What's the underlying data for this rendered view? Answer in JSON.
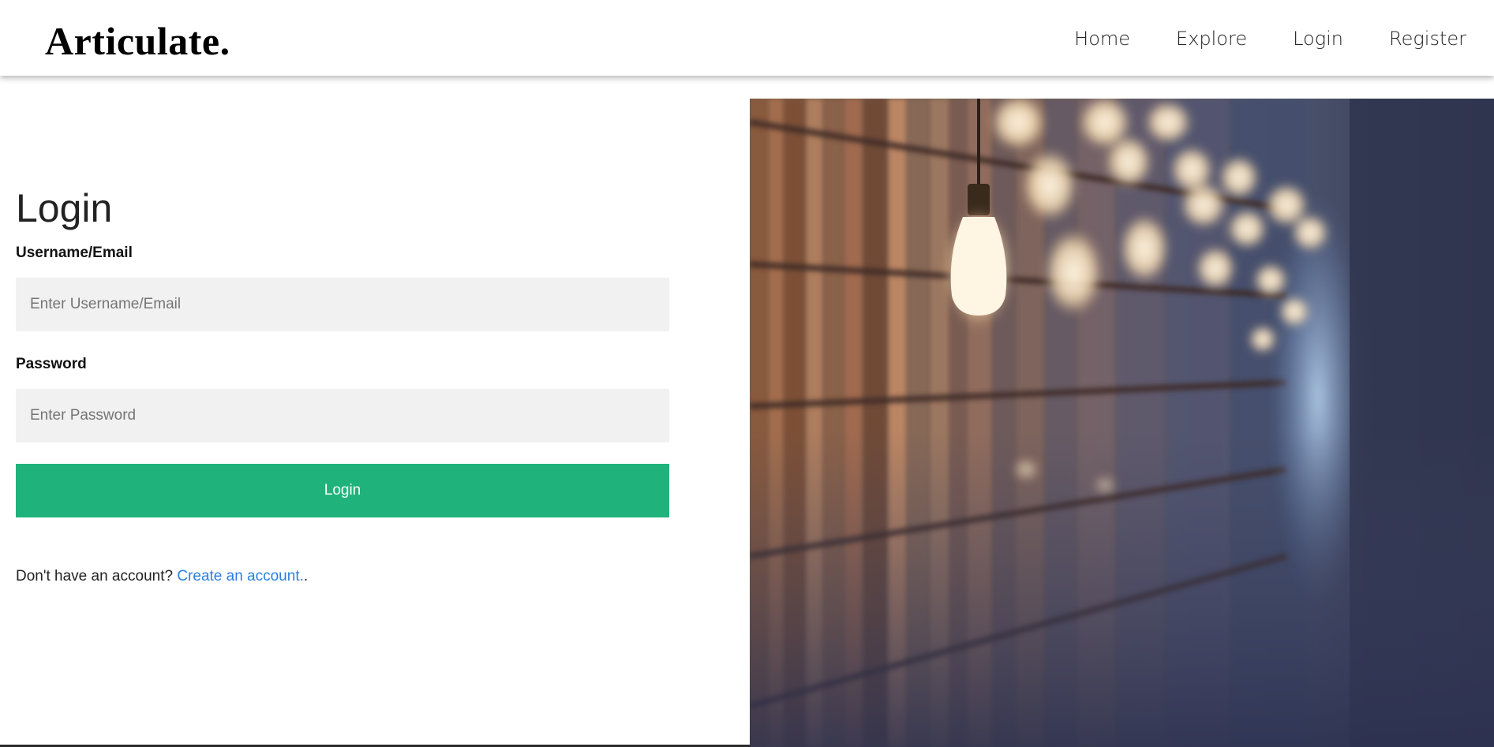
{
  "header": {
    "brand": "Articulate.",
    "nav": [
      "Home",
      "Explore",
      "Login",
      "Register"
    ]
  },
  "login_form": {
    "title": "Login",
    "username_label": "Username/Email",
    "username_placeholder": "Enter Username/Email",
    "password_label": "Password",
    "password_placeholder": "Enter Password",
    "submit_label": "Login",
    "register_prompt": "Don't have an account?",
    "register_link": "Create an account.",
    "register_suffix": "."
  },
  "hero_image": {
    "icon": "library-bookshelves-with-hanging-lightbulbs-photo"
  },
  "colors": {
    "accent": "#1fb37b",
    "link": "#2a7fe0",
    "input_bg": "#f1f1f1"
  }
}
